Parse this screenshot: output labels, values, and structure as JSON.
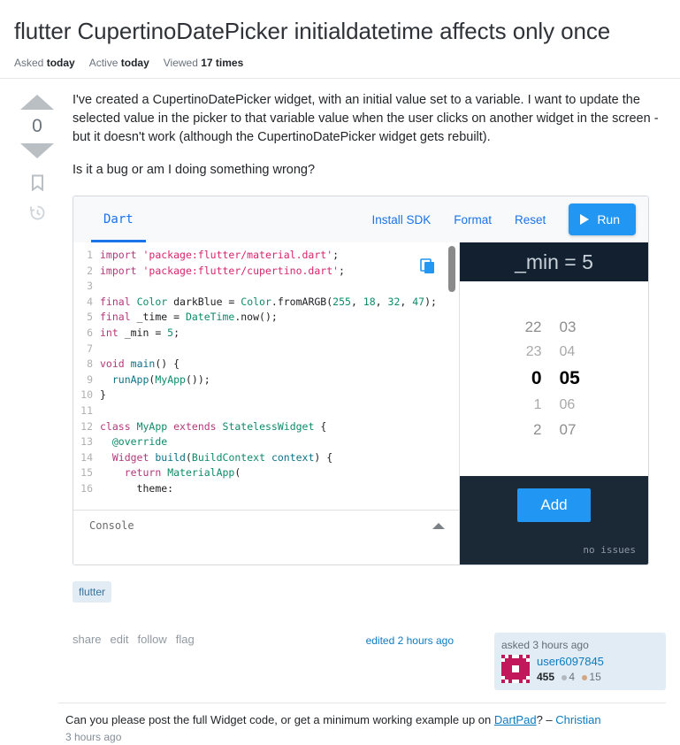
{
  "question": {
    "title": "flutter CupertinoDatePicker initialdatetime affects only once",
    "meta": [
      {
        "label": "Asked",
        "value": "today"
      },
      {
        "label": "Active",
        "value": "today"
      },
      {
        "label": "Viewed",
        "value": "17 times"
      }
    ],
    "vote_count": "0",
    "body_paragraphs": [
      "I've created a CupertinoDatePicker widget, with an initial value set to a variable. I want to update the selected value in the picker to that variable value when the user clicks on another widget in the screen - but it doesn't work (although the CupertinoDatePicker widget gets rebuilt).",
      "Is it a bug or am I doing something wrong?"
    ],
    "tags": [
      "flutter"
    ],
    "actions": [
      "share",
      "edit",
      "follow",
      "flag"
    ],
    "edited": "edited 2 hours ago",
    "owner": {
      "asked": "asked 3 hours ago",
      "name": "user6097845",
      "reputation": "455",
      "silver_badges": "4",
      "bronze_badges": "15"
    }
  },
  "dartpad": {
    "tab": "Dart",
    "links": [
      "Install SDK",
      "Format",
      "Reset"
    ],
    "run_label": "Run",
    "console_label": "Console",
    "copy_icon": "copy-icon",
    "code_lines": [
      {
        "n": "1",
        "tokens": [
          {
            "t": "import",
            "c": "kw"
          },
          {
            "t": " ",
            "c": "var"
          },
          {
            "t": "'package:flutter/material.dart'",
            "c": "str"
          },
          {
            "t": ";",
            "c": "var"
          }
        ]
      },
      {
        "n": "2",
        "tokens": [
          {
            "t": "import",
            "c": "kw"
          },
          {
            "t": " ",
            "c": "var"
          },
          {
            "t": "'package:flutter/cupertino.dart'",
            "c": "str"
          },
          {
            "t": ";",
            "c": "var"
          }
        ]
      },
      {
        "n": "3",
        "tokens": []
      },
      {
        "n": "4",
        "tokens": [
          {
            "t": "final",
            "c": "kw"
          },
          {
            "t": " ",
            "c": "var"
          },
          {
            "t": "Color",
            "c": "cls"
          },
          {
            "t": " darkBlue = ",
            "c": "var"
          },
          {
            "t": "Color",
            "c": "cls"
          },
          {
            "t": ".fromARGB(",
            "c": "var"
          },
          {
            "t": "255",
            "c": "typ"
          },
          {
            "t": ", ",
            "c": "var"
          },
          {
            "t": "18",
            "c": "typ"
          },
          {
            "t": ", ",
            "c": "var"
          },
          {
            "t": "32",
            "c": "typ"
          },
          {
            "t": ", ",
            "c": "var"
          },
          {
            "t": "47",
            "c": "typ"
          },
          {
            "t": ");",
            "c": "var"
          }
        ]
      },
      {
        "n": "5",
        "tokens": [
          {
            "t": "final",
            "c": "kw"
          },
          {
            "t": " _time = ",
            "c": "var"
          },
          {
            "t": "DateTime",
            "c": "cls"
          },
          {
            "t": ".now();",
            "c": "var"
          }
        ]
      },
      {
        "n": "6",
        "tokens": [
          {
            "t": "int",
            "c": "kw"
          },
          {
            "t": " _min = ",
            "c": "var"
          },
          {
            "t": "5",
            "c": "typ"
          },
          {
            "t": ";",
            "c": "var"
          }
        ]
      },
      {
        "n": "7",
        "tokens": []
      },
      {
        "n": "8",
        "tokens": [
          {
            "t": "void",
            "c": "kw"
          },
          {
            "t": " ",
            "c": "var"
          },
          {
            "t": "main",
            "c": "fn"
          },
          {
            "t": "() {",
            "c": "var"
          }
        ]
      },
      {
        "n": "9",
        "tokens": [
          {
            "t": "  ",
            "c": "var"
          },
          {
            "t": "runApp",
            "c": "fn"
          },
          {
            "t": "(",
            "c": "var"
          },
          {
            "t": "MyApp",
            "c": "cls"
          },
          {
            "t": "());",
            "c": "var"
          }
        ]
      },
      {
        "n": "10",
        "tokens": [
          {
            "t": "}",
            "c": "var"
          }
        ]
      },
      {
        "n": "11",
        "tokens": []
      },
      {
        "n": "12",
        "tokens": [
          {
            "t": "class",
            "c": "kw"
          },
          {
            "t": " ",
            "c": "var"
          },
          {
            "t": "MyApp",
            "c": "cls"
          },
          {
            "t": " ",
            "c": "var"
          },
          {
            "t": "extends",
            "c": "kw"
          },
          {
            "t": " ",
            "c": "var"
          },
          {
            "t": "StatelessWidget",
            "c": "cls"
          },
          {
            "t": " {",
            "c": "var"
          }
        ]
      },
      {
        "n": "13",
        "tokens": [
          {
            "t": "  @override",
            "c": "ann"
          }
        ]
      },
      {
        "n": "14",
        "tokens": [
          {
            "t": "  ",
            "c": "var"
          },
          {
            "t": "Widget",
            "c": "kw"
          },
          {
            "t": " ",
            "c": "var"
          },
          {
            "t": "build",
            "c": "fn"
          },
          {
            "t": "(",
            "c": "var"
          },
          {
            "t": "BuildContext",
            "c": "cls"
          },
          {
            "t": " ",
            "c": "var"
          },
          {
            "t": "context",
            "c": "fn"
          },
          {
            "t": ") {",
            "c": "var"
          }
        ]
      },
      {
        "n": "15",
        "tokens": [
          {
            "t": "    ",
            "c": "var"
          },
          {
            "t": "return",
            "c": "kw"
          },
          {
            "t": " ",
            "c": "var"
          },
          {
            "t": "MaterialApp",
            "c": "cls"
          },
          {
            "t": "(",
            "c": "var"
          }
        ]
      },
      {
        "n": "16",
        "tokens": [
          {
            "t": "      theme:",
            "c": "var"
          }
        ]
      }
    ],
    "preview": {
      "app_bar_title": "_min = 5",
      "hours": [
        "22",
        "23",
        "0",
        "1",
        "2"
      ],
      "minutes": [
        "03",
        "04",
        "05",
        "06",
        "07"
      ],
      "selected_index": 2,
      "add_label": "Add",
      "status": "no issues"
    }
  },
  "comment": {
    "text_before": "Can you please post the full Widget code, or get a minimum working example up on ",
    "link": "DartPad",
    "text_after": "? – ",
    "author": "Christian",
    "time": "3 hours ago"
  },
  "colors": {
    "accent_blue": "#2196f3",
    "link_blue": "#0c7bc0",
    "tag_bg": "#e1ecf4",
    "app_bar": "#12202f",
    "app_foot": "#1b2836"
  }
}
